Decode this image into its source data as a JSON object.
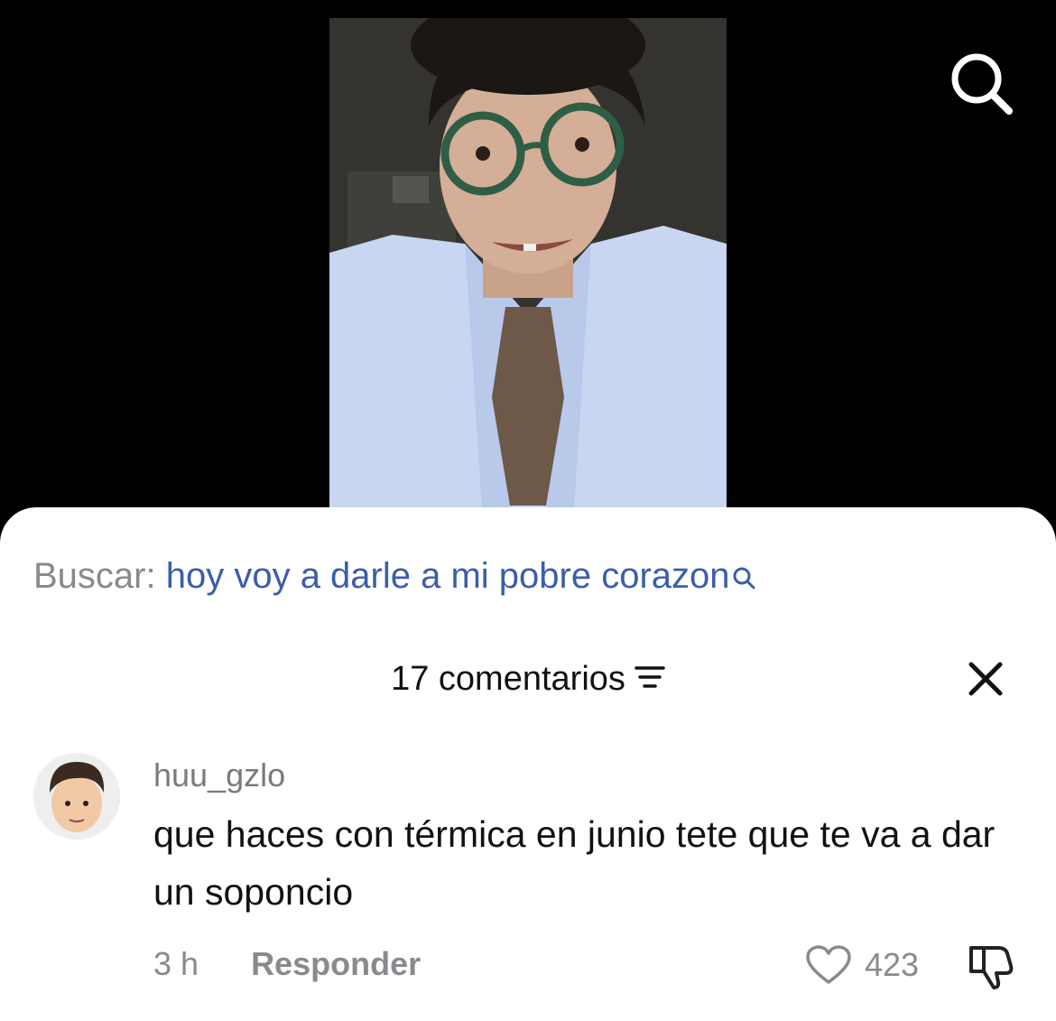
{
  "colors": {
    "accent_link": "#3b5ea8",
    "muted_text": "#8a8a8e",
    "primary_text": "#111111",
    "sheet_background": "#ffffff",
    "video_background": "#000000"
  },
  "video": {
    "description_icon": "search-icon"
  },
  "search": {
    "label": "Buscar:",
    "query": "hoy voy a darle a mi pobre corazon",
    "icon": "search-icon"
  },
  "comments": {
    "title": "17 comentarios",
    "sort_icon": "sort-icon",
    "close_icon": "close-icon"
  },
  "comment": {
    "username": "huu_gzlo",
    "text": "que haces con térmica en junio tete que te va a dar un soponcio",
    "time": "3 h",
    "reply_label": "Responder",
    "like_count": "423",
    "like_icon": "heart-icon",
    "dislike_icon": "thumbs-down-icon"
  }
}
